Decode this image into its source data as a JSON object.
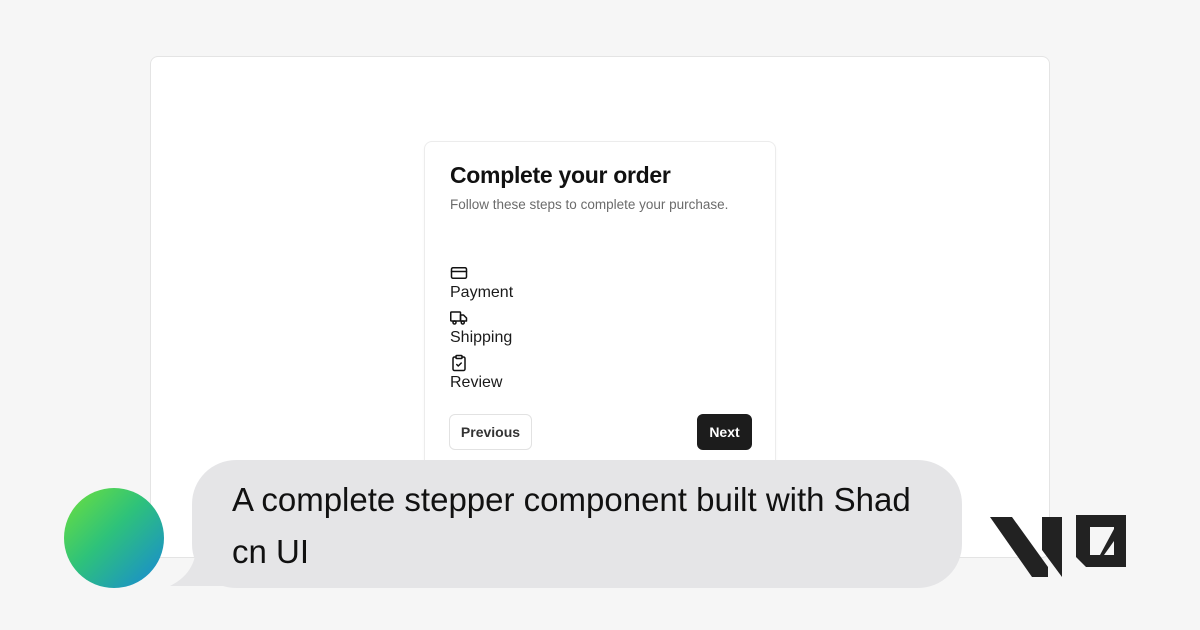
{
  "card": {
    "title": "Complete your order",
    "description": "Follow these steps to complete your purchase."
  },
  "steps": [
    {
      "label": "Payment",
      "icon": "credit-card-icon"
    },
    {
      "label": "Shipping",
      "icon": "truck-icon"
    },
    {
      "label": "Review",
      "icon": "clipboard-check-icon"
    }
  ],
  "buttons": {
    "previous_label": "Previous",
    "next_label": "Next"
  },
  "banner": {
    "caption": "A complete stepper component built with Shadcn UI",
    "logo": "v0-logo"
  },
  "colors": {
    "background": "#f6f6f6",
    "card": "#ffffff",
    "primary_button": "#1c1c1c",
    "bubble": "#e5e5e7",
    "avatar_gradient": [
      "#6fe13a",
      "#1787d8"
    ]
  }
}
